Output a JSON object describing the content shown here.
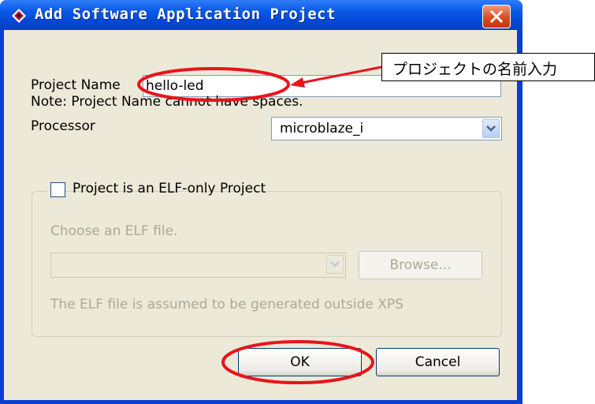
{
  "dialog": {
    "title": "Add Software Application Project",
    "title_icon": "xps-app-icon",
    "close_icon": "close-icon"
  },
  "form": {
    "project_name_label": "Project Name",
    "project_name_value": "hello-led",
    "note": "Note: Project Name cannot have spaces.",
    "processor_label": "Processor",
    "processor_value": "microblaze_i",
    "elf_only_label": "Project is an ELF-only Project",
    "elf_only_checked": false,
    "choose_elf_label": "Choose an ELF file.",
    "elf_file_value": "",
    "browse_label": "Browse...",
    "elf_note": "The ELF file is assumed to be generated outside XPS"
  },
  "buttons": {
    "ok_label": "OK",
    "cancel_label": "Cancel"
  },
  "annotations": {
    "callout_text": "プロジェクトの名前入力",
    "highlight_color": "#e8141c"
  },
  "colors": {
    "titlebar_blue": "#0a5be8",
    "dialog_bg": "#ece9d8",
    "close_red": "#d9451c"
  }
}
